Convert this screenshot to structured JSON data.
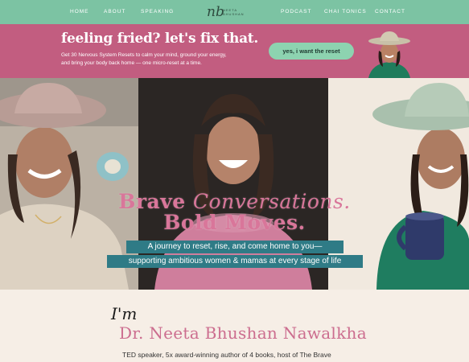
{
  "nav": {
    "left_links": [
      "HOME",
      "ABOUT",
      "SPEAKING"
    ],
    "right_links": [
      "PODCAST",
      "CHAI TONICS",
      "CONTACT"
    ],
    "logo": {
      "mark": "nb",
      "name_line1": "NEETA",
      "name_line2": "BHUSHAN"
    }
  },
  "promo": {
    "headline": "feeling fried? let's fix that.",
    "subtext_line1": "Get 30 Nervous System Resets to calm your mind, ground your energy,",
    "subtext_line2": "and bring your body back home — one micro-reset at a time.",
    "cta_label": "yes, i want the reset"
  },
  "hero": {
    "title_word1": "Brave",
    "title_word2": "Conversations.",
    "title_line2": "Bold Moves.",
    "tagline_1": "A journey to reset, rise, and come home to you—",
    "tagline_2": "supporting ambitious women & mamas at every stage of life"
  },
  "intro": {
    "im": "I'm",
    "name": "Dr. Neeta Bhushan Nawalkha",
    "bio": "TED speaker, 5x award-winning author of 4 books, host of The Brave"
  },
  "colors": {
    "nav_bg": "#7cc3a3",
    "promo_bg": "#c25d80",
    "cta_bg": "#8dd3b0",
    "title_pink": "#d9769a",
    "tag_teal": "#2f7b86",
    "page_bg": "#f6eee6"
  }
}
